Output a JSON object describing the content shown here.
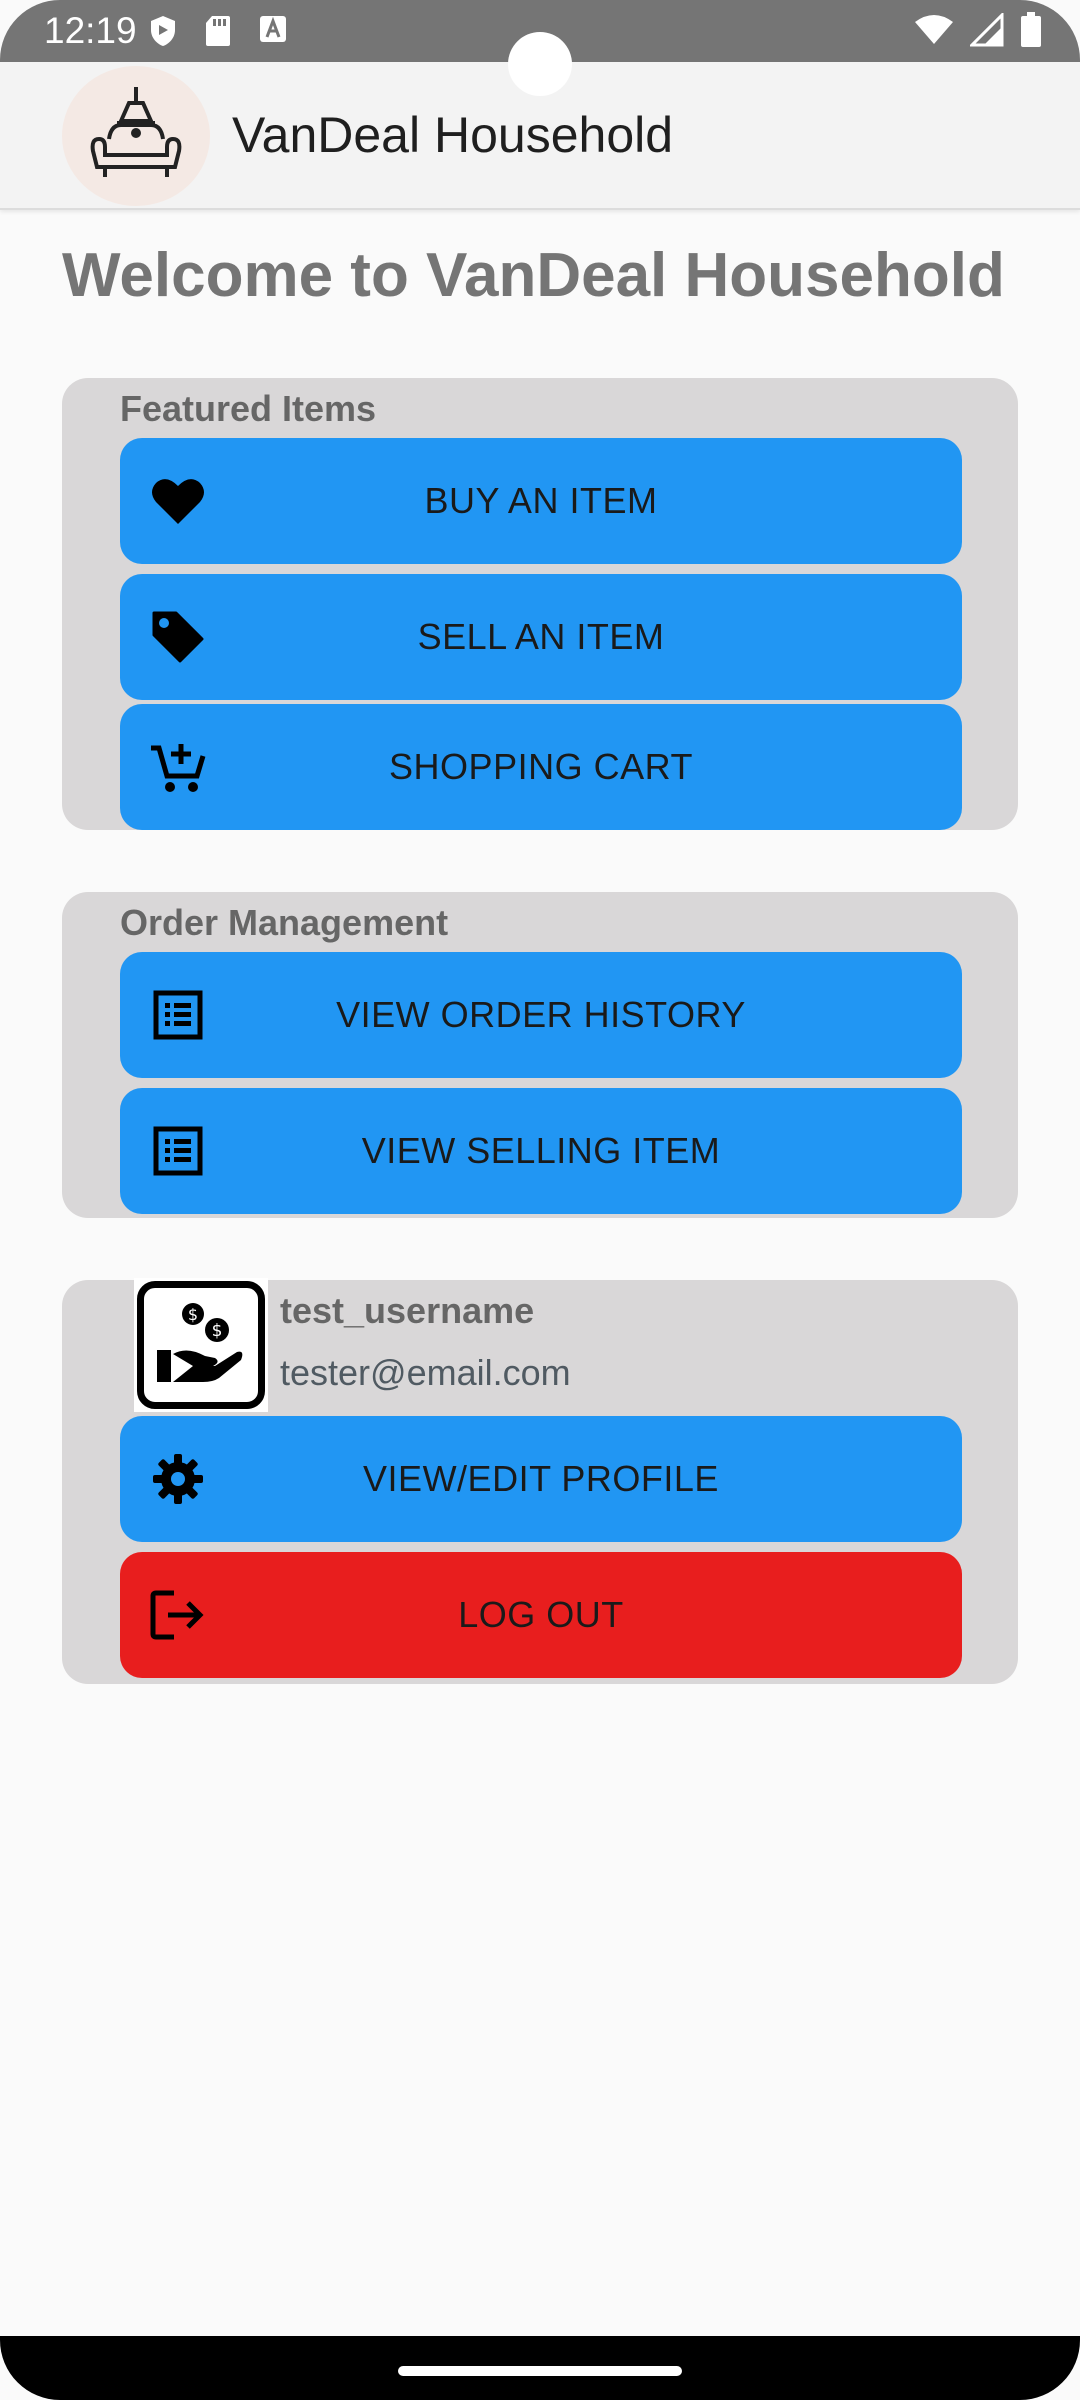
{
  "status_bar": {
    "time": "12:19",
    "left_icons": [
      "shield-icon",
      "sd-card-icon",
      "text-a-icon"
    ],
    "right_icons": [
      "wifi-icon",
      "signal-icon",
      "battery-icon"
    ]
  },
  "app_bar": {
    "title": "VanDeal Household",
    "logo": "lamp-sofa-logo"
  },
  "welcome": "Welcome to VanDeal Household",
  "featured": {
    "title": "Featured Items",
    "buttons": [
      {
        "label": "BUY AN ITEM",
        "icon": "heart-icon"
      },
      {
        "label": "SELL AN ITEM",
        "icon": "tag-icon"
      },
      {
        "label": "SHOPPING CART",
        "icon": "add-cart-icon"
      }
    ]
  },
  "orders": {
    "title": "Order Management",
    "buttons": [
      {
        "label": "VIEW ORDER HISTORY",
        "icon": "list-icon"
      },
      {
        "label": "VIEW SELLING ITEM",
        "icon": "list-icon"
      }
    ]
  },
  "profile": {
    "username": "test_username",
    "email": "tester@email.com",
    "avatar": "hand-money-icon",
    "buttons": [
      {
        "label": "VIEW/EDIT PROFILE",
        "icon": "gear-icon"
      },
      {
        "label": "LOG OUT",
        "icon": "logout-icon"
      }
    ]
  },
  "colors": {
    "primary_button": "#2196f3",
    "logout_button": "#e81e1e",
    "card_bg": "#d9d7d8",
    "heading_gray": "#757575"
  }
}
